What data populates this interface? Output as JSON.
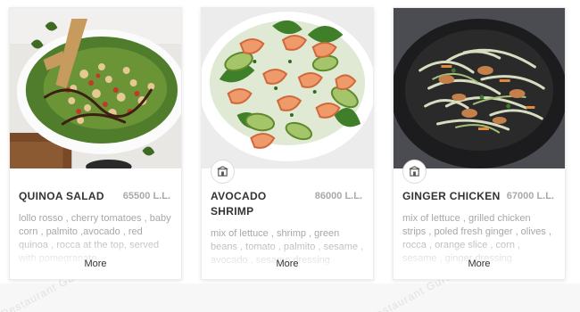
{
  "cards": [
    {
      "name": "QUINOA SALAD",
      "price": "65500 L.L.",
      "description": "lollo rosso , cherry tomatoes , baby corn , palmito ,avocado , red quinoa , rocca at the top, served with pomegranate",
      "more_label": "More",
      "image_icon": "quinoa-salad-photo",
      "show_badge": false
    },
    {
      "name": "AVOCADO SHRIMP",
      "price": "86000 L.L.",
      "description": "mix of lettuce , shrimp , green beans , tomato , palmito , sesame , avocado , sesame dressing",
      "more_label": "More",
      "image_icon": "avocado-shrimp-photo",
      "show_badge": true
    },
    {
      "name": "GINGER CHICKEN",
      "price": "67000 L.L.",
      "description": "mix of lettuce , grilled chicken strips , poled fresh ginger , olives , rocca , orange slice , corn , sesame , ginger dressing",
      "more_label": "More",
      "image_icon": "ginger-chicken-photo",
      "show_badge": true
    }
  ],
  "watermark": "Restaurant Guru",
  "colors": {
    "title": "#333333",
    "price": "#a9a9a9",
    "description": "#a7a7a7",
    "card_border": "#ececec",
    "watermark": "#e2e2e2"
  }
}
